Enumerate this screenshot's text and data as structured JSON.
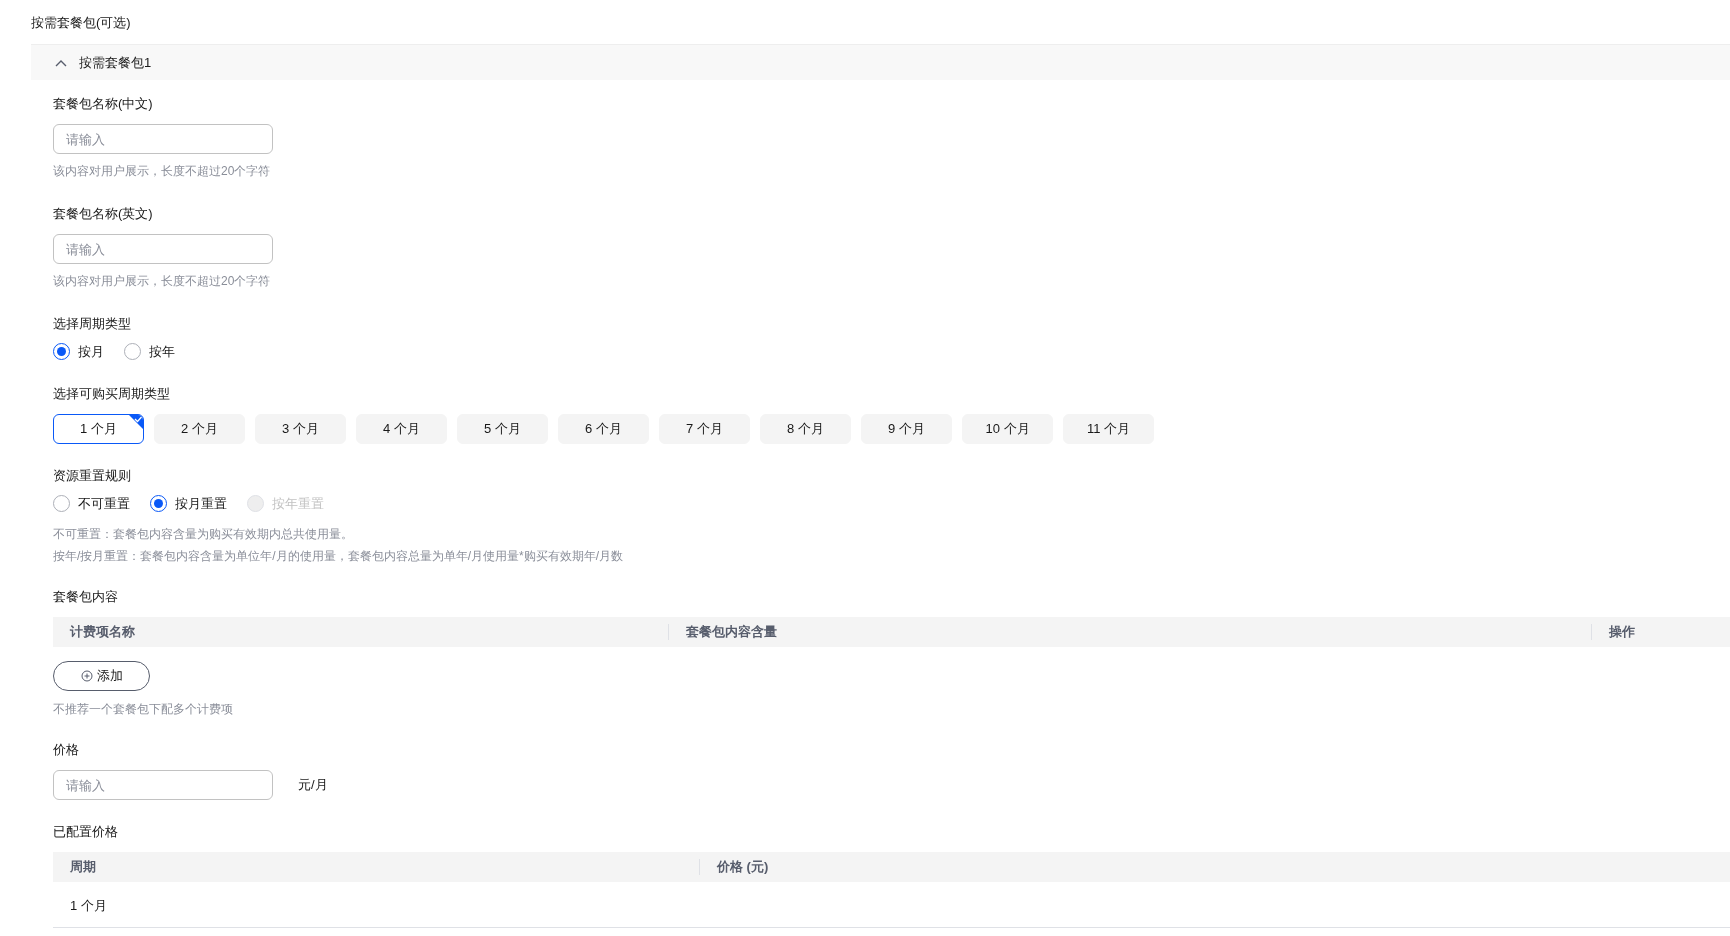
{
  "section_title": "按需套餐包(可选)",
  "package": {
    "title": "按需套餐包1",
    "expanded": true,
    "name_cn": {
      "label": "套餐包名称(中文)",
      "placeholder": "请输入",
      "hint": "该内容对用户展示，长度不超过20个字符"
    },
    "name_en": {
      "label": "套餐包名称(英文)",
      "placeholder": "请输入",
      "hint": "该内容对用户展示，长度不超过20个字符"
    },
    "period_type": {
      "label": "选择周期类型",
      "options": [
        {
          "label": "按月",
          "selected": true,
          "disabled": false
        },
        {
          "label": "按年",
          "selected": false,
          "disabled": false
        }
      ]
    },
    "purchasable_periods": {
      "label": "选择可购买周期类型",
      "options": [
        {
          "label": "1 个月",
          "selected": true
        },
        {
          "label": "2 个月",
          "selected": false
        },
        {
          "label": "3 个月",
          "selected": false
        },
        {
          "label": "4 个月",
          "selected": false
        },
        {
          "label": "5 个月",
          "selected": false
        },
        {
          "label": "6 个月",
          "selected": false
        },
        {
          "label": "7 个月",
          "selected": false
        },
        {
          "label": "8 个月",
          "selected": false
        },
        {
          "label": "9 个月",
          "selected": false
        },
        {
          "label": "10 个月",
          "selected": false
        },
        {
          "label": "11 个月",
          "selected": false
        }
      ]
    },
    "reset_rule": {
      "label": "资源重置规则",
      "options": [
        {
          "label": "不可重置",
          "selected": false,
          "disabled": false
        },
        {
          "label": "按月重置",
          "selected": true,
          "disabled": false
        },
        {
          "label": "按年重置",
          "selected": false,
          "disabled": true
        }
      ],
      "notes": [
        "不可重置：套餐包内容含量为购买有效期内总共使用量。",
        "按年/按月重置：套餐包内容含量为单位年/月的使用量，套餐包内容总量为单年/月使用量*购买有效期年/月数"
      ]
    },
    "contents": {
      "label": "套餐包内容",
      "columns": [
        "计费项名称",
        "套餐包内容含量",
        "操作"
      ],
      "add_button": "添加",
      "hint": "不推荐一个套餐包下配多个计费项"
    },
    "price": {
      "label": "价格",
      "placeholder": "请输入",
      "unit": "元/月"
    },
    "configured_prices": {
      "label": "已配置价格",
      "columns": [
        "周期",
        "价格 (元)"
      ],
      "rows": [
        [
          "1 个月"
        ]
      ]
    }
  }
}
